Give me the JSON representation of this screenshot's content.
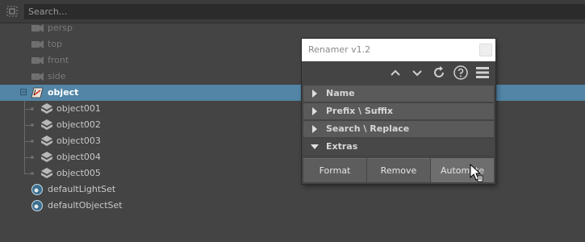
{
  "search": {
    "placeholder": "Search..."
  },
  "outliner": {
    "cameras": [
      {
        "name": "persp"
      },
      {
        "name": "top"
      },
      {
        "name": "front"
      },
      {
        "name": "side"
      }
    ],
    "group": {
      "name": "object",
      "expand_symbol": "⊟"
    },
    "children": [
      {
        "name": "object001"
      },
      {
        "name": "object002"
      },
      {
        "name": "object003"
      },
      {
        "name": "object004"
      },
      {
        "name": "object005"
      }
    ],
    "sets": [
      {
        "name": "defaultLightSet"
      },
      {
        "name": "defaultObjectSet"
      }
    ]
  },
  "renamer": {
    "title": "Renamer v1.2",
    "sections": [
      {
        "label": "Name",
        "expanded": false
      },
      {
        "label": "Prefix \\ Suffix",
        "expanded": false
      },
      {
        "label": "Search \\ Replace",
        "expanded": false
      },
      {
        "label": "Extras",
        "expanded": true
      }
    ],
    "buttons": {
      "format": "Format",
      "remove": "Remove",
      "automate": "Automate"
    }
  },
  "colors": {
    "selection": "#5285a6",
    "background": "#444444"
  }
}
